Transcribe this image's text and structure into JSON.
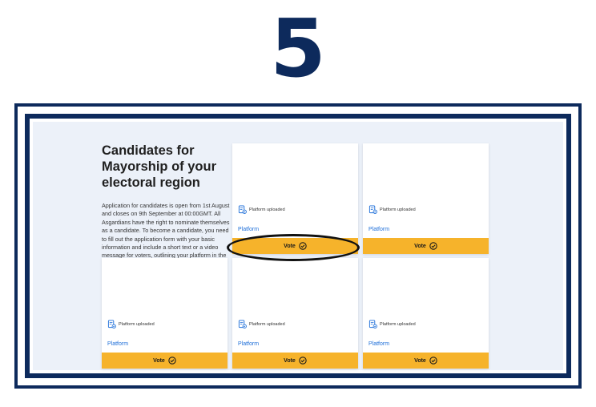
{
  "step_number": "5",
  "intro": {
    "heading": "Candidates for Mayorship of your electoral region",
    "description": "Application for candidates is open from 1st August and closes on 9th September at 00:00GMT. All Asgardians have the right to nominate themselves as a candidate. To become a candidate, you need to fill out the application form with your basic information and include a short text or a video message for voters, outlining your platform in the election."
  },
  "cards": [
    {
      "status": "Platform uploaded",
      "platform_link": "Platform",
      "vote_label": "Vote"
    },
    {
      "status": "Platform uploaded",
      "platform_link": "Platform",
      "vote_label": "Vote"
    },
    {
      "status": "Platform uploaded",
      "platform_link": "Platform",
      "vote_label": "Vote"
    },
    {
      "status": "Platform uploaded",
      "platform_link": "Platform",
      "vote_label": "Vote"
    },
    {
      "status": "Platform uploaded",
      "platform_link": "Platform",
      "vote_label": "Vote"
    }
  ],
  "colors": {
    "navy": "#0d2a5c",
    "panel_bg": "#ecf1f9",
    "vote_button": "#f6b32b",
    "link": "#1e6fd9"
  },
  "icons": {
    "status": "document-check-icon",
    "vote": "check-circle-icon"
  },
  "annotation": "highlight-ellipse around first card vote button"
}
